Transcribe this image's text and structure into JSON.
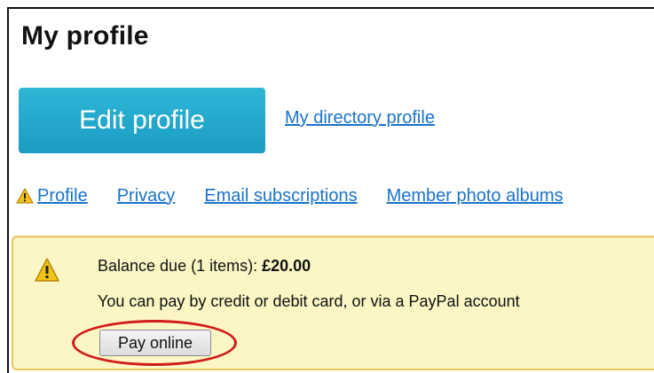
{
  "page": {
    "title": "My profile"
  },
  "actions": {
    "edit_profile_label": "Edit profile",
    "directory_link_label": "My directory profile"
  },
  "tabs": [
    {
      "label": "Profile",
      "icon": "warning-icon"
    },
    {
      "label": "Privacy"
    },
    {
      "label": "Email subscriptions"
    },
    {
      "label": "Member photo albums"
    }
  ],
  "notice": {
    "icon": "warning-icon",
    "balance_prefix": "Balance due (1 items): ",
    "balance_amount": "£20.00",
    "payment_info": "You can pay by credit or debit card, or via a PayPal account",
    "pay_button_label": "Pay online"
  },
  "colors": {
    "edit_button_bg": "#1a9cc3",
    "link": "#1a73c8",
    "notice_bg": "#fbf6c4",
    "notice_border": "#e8c85a",
    "highlight_ring": "#d21a1a"
  }
}
